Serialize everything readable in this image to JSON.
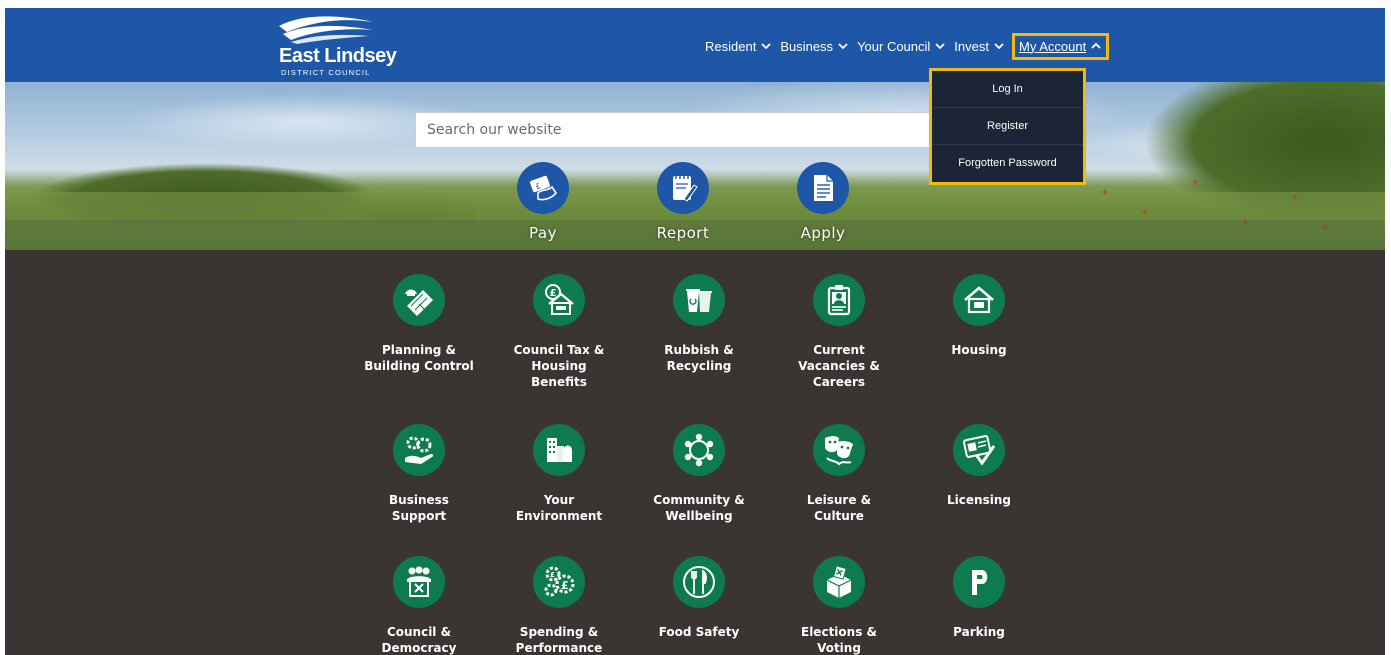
{
  "header": {
    "logo": {
      "name": "East Lindsey",
      "subtitle": "DISTRICT COUNCIL"
    },
    "nav": [
      {
        "label": "Resident",
        "icon": "chevron-down-icon"
      },
      {
        "label": "Business",
        "icon": "chevron-down-icon"
      },
      {
        "label": "Your Council",
        "icon": "chevron-down-icon"
      },
      {
        "label": "Invest",
        "icon": "chevron-down-icon"
      },
      {
        "label": "My Account",
        "icon": "chevron-up-icon",
        "expanded": true
      }
    ]
  },
  "account_menu": {
    "items": [
      "Log In",
      "Register",
      "Forgotten Password"
    ]
  },
  "search": {
    "placeholder": "Search our website",
    "icon": "search-icon"
  },
  "quick_links": [
    {
      "label": "Pay",
      "icon": "card-payment-icon"
    },
    {
      "label": "Report",
      "icon": "notepad-pencil-icon"
    },
    {
      "label": "Apply",
      "icon": "document-icon"
    }
  ],
  "services": [
    {
      "label": "Planning & Building Control",
      "icon": "planning-icon"
    },
    {
      "label": "Council Tax & Housing Benefits",
      "icon": "council-tax-house-icon"
    },
    {
      "label": "Rubbish & Recycling",
      "icon": "bins-icon"
    },
    {
      "label": "Current Vacancies & Careers",
      "icon": "id-badge-icon"
    },
    {
      "label": "Housing",
      "icon": "house-icon"
    },
    {
      "label": "Business Support",
      "icon": "gears-hand-icon"
    },
    {
      "label": "Your Environment",
      "icon": "buildings-icon"
    },
    {
      "label": "Community & Wellbeing",
      "icon": "community-circle-icon"
    },
    {
      "label": "Leisure & Culture",
      "icon": "theatre-masks-icon"
    },
    {
      "label": "Licensing",
      "icon": "licence-card-icon"
    },
    {
      "label": "Council & Democracy",
      "icon": "people-ballot-icon"
    },
    {
      "label": "Spending & Performance",
      "icon": "pound-gears-icon"
    },
    {
      "label": "Food Safety",
      "icon": "knife-fork-icon"
    },
    {
      "label": "Elections & Voting",
      "icon": "ballot-box-icon"
    },
    {
      "label": "Parking",
      "icon": "parking-icon"
    }
  ],
  "colors": {
    "header_blue": "#1e57a8",
    "focus_yellow": "#f2b90f",
    "menu_dark": "#1b2535",
    "service_green": "#0e7a4f",
    "services_bg": "#3a3533"
  }
}
